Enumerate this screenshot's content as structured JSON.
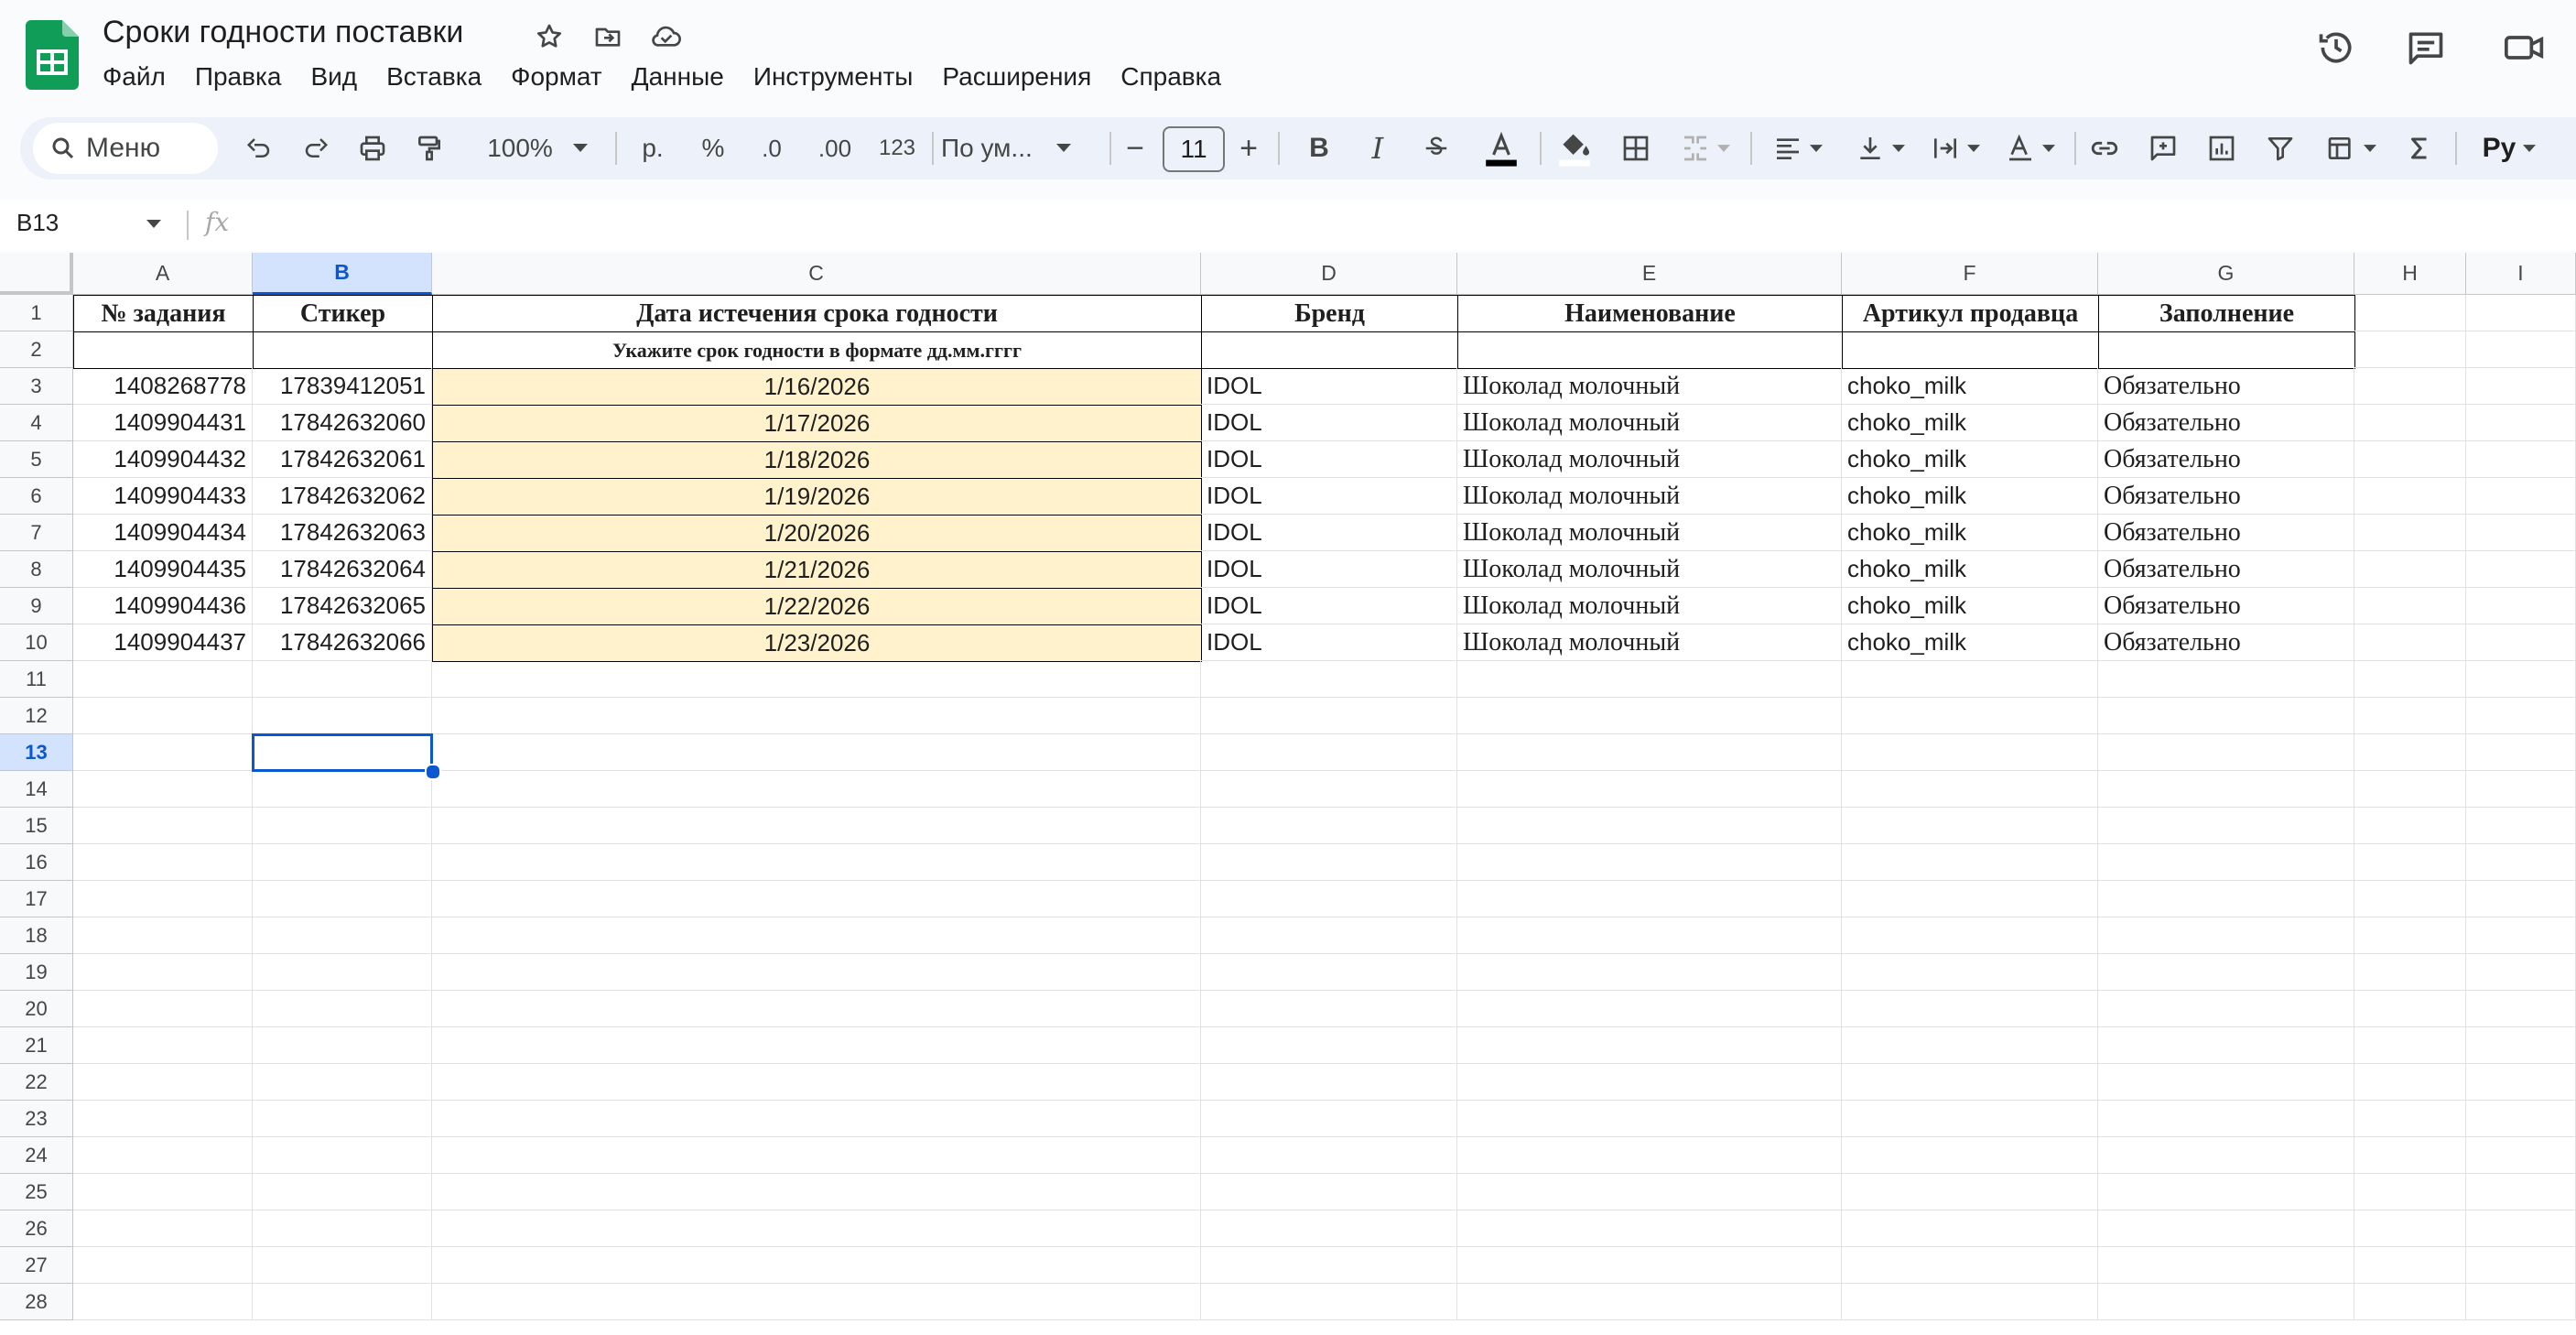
{
  "app": {
    "title": "Сроки годности поставки",
    "menu": [
      "Файл",
      "Правка",
      "Вид",
      "Вставка",
      "Формат",
      "Данные",
      "Инструменты",
      "Расширения",
      "Справка"
    ],
    "brand_color": "#0f9d58"
  },
  "toolbar": {
    "search_label": "Меню",
    "zoom": "100%",
    "currency": "р.",
    "percent": "%",
    "dec_decrease": ".0",
    "dec_increase": ".00",
    "number_format": "123",
    "font_name": "По ум...",
    "font_size": "11",
    "minus": "−",
    "plus": "+",
    "bold": "B",
    "italic": "I",
    "input_tools": "Ру"
  },
  "formula_bar": {
    "name_box": "B13",
    "fx": "fx",
    "value": ""
  },
  "sheet": {
    "columns": [
      "A",
      "B",
      "C",
      "D",
      "E",
      "F",
      "G",
      "H",
      "I"
    ],
    "selected_column": "B",
    "selected_row": "13",
    "rows": [
      "1",
      "2",
      "3",
      "4",
      "5",
      "6",
      "7",
      "8",
      "9",
      "10",
      "11",
      "12",
      "13",
      "14",
      "15",
      "16",
      "17",
      "18",
      "19",
      "20",
      "21",
      "22",
      "23",
      "24",
      "25",
      "26",
      "27",
      "28"
    ],
    "header_row": [
      "№ задания",
      "Стикер",
      "Дата истечения срока годности",
      "Бренд",
      "Наименование",
      "Артикул продавца",
      "Заполнение"
    ],
    "hint_row": "Укажите срок годности в формате дд.мм.гггг",
    "data_rows": [
      [
        "1408268778",
        "17839412051",
        "1/16/2026",
        "IDOL",
        "Шоколад молочный",
        "choko_milk",
        "Обязательно"
      ],
      [
        "1409904431",
        "17842632060",
        "1/17/2026",
        "IDOL",
        "Шоколад молочный",
        "choko_milk",
        "Обязательно"
      ],
      [
        "1409904432",
        "17842632061",
        "1/18/2026",
        "IDOL",
        "Шоколад молочный",
        "choko_milk",
        "Обязательно"
      ],
      [
        "1409904433",
        "17842632062",
        "1/19/2026",
        "IDOL",
        "Шоколад молочный",
        "choko_milk",
        "Обязательно"
      ],
      [
        "1409904434",
        "17842632063",
        "1/20/2026",
        "IDOL",
        "Шоколад молочный",
        "choko_milk",
        "Обязательно"
      ],
      [
        "1409904435",
        "17842632064",
        "1/21/2026",
        "IDOL",
        "Шоколад молочный",
        "choko_milk",
        "Обязательно"
      ],
      [
        "1409904436",
        "17842632065",
        "1/22/2026",
        "IDOL",
        "Шоколад молочный",
        "choko_milk",
        "Обязательно"
      ],
      [
        "1409904437",
        "17842632066",
        "1/23/2026",
        "IDOL",
        "Шоколад молочный",
        "choko_milk",
        "Обязательно"
      ]
    ],
    "date_fill_color": "#fff2cc",
    "selection_color": "#0b57d0"
  }
}
